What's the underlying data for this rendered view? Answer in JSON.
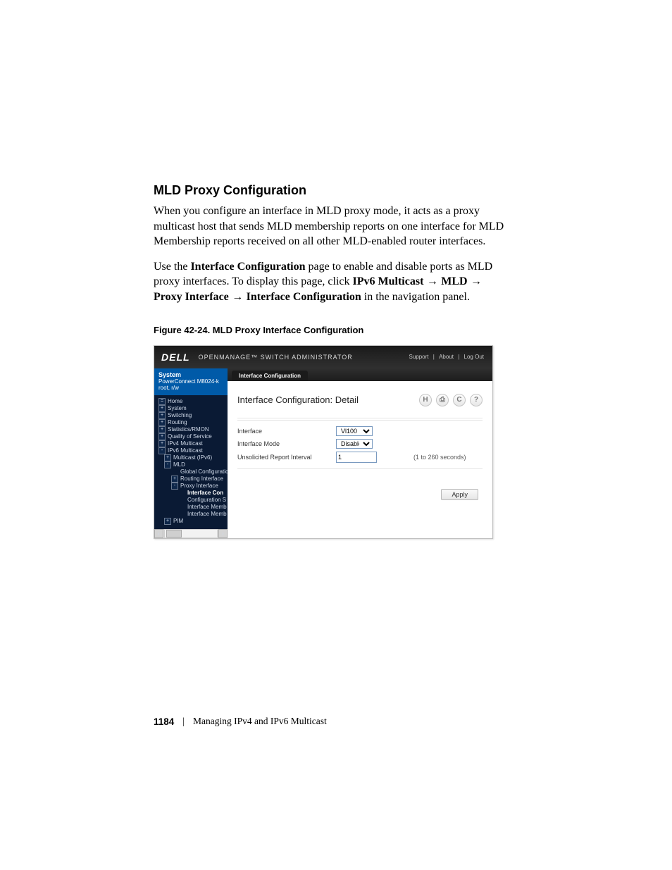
{
  "doc": {
    "section_title": "MLD Proxy Configuration",
    "p1": "When you configure an interface in MLD proxy mode, it acts as a proxy multicast host that sends MLD membership reports on one interface for MLD Membership reports received on all other MLD-enabled router interfaces.",
    "p2a": "Use the ",
    "p2_link": "Interface Configuration",
    "p2b": " page to enable and disable ports as MLD proxy interfaces. To display this page, click ",
    "bc1": "IPv6 Multicast",
    "bc2": "MLD",
    "bc3": "Proxy Interface",
    "bc4": "Interface Configuration",
    "p2c": " in the navigation panel.",
    "fig_caption": "Figure 42-24.    MLD Proxy Interface Configuration"
  },
  "shot": {
    "brand": "DELL",
    "subtitle": "OPENMANAGE™ SWITCH ADMINISTRATOR",
    "top_links": {
      "support": "Support",
      "about": "About",
      "logout": "Log Out"
    },
    "sidebar": {
      "sys_title": "System",
      "sys_line1": "PowerConnect M8024-k",
      "sys_line2": "root, r/w",
      "items": [
        {
          "toggle": "=",
          "label": "Home",
          "cls": ""
        },
        {
          "toggle": "+",
          "label": "System",
          "cls": ""
        },
        {
          "toggle": "+",
          "label": "Switching",
          "cls": ""
        },
        {
          "toggle": "+",
          "label": "Routing",
          "cls": ""
        },
        {
          "toggle": "+",
          "label": "Statistics/RMON",
          "cls": ""
        },
        {
          "toggle": "+",
          "label": "Quality of Service",
          "cls": ""
        },
        {
          "toggle": "+",
          "label": "IPv4 Multicast",
          "cls": ""
        },
        {
          "toggle": "-",
          "label": "IPv6 Multicast",
          "cls": ""
        },
        {
          "toggle": "+",
          "label": "Multicast (IPv6)",
          "cls": "ind1"
        },
        {
          "toggle": "-",
          "label": "MLD",
          "cls": "ind1"
        },
        {
          "toggle": "",
          "label": "Global Configuratio",
          "cls": "ind2 noicon"
        },
        {
          "toggle": "+",
          "label": "Routing Interface",
          "cls": "ind2"
        },
        {
          "toggle": "-",
          "label": "Proxy Interface",
          "cls": "ind2"
        },
        {
          "toggle": "",
          "label": "Interface Con",
          "cls": "ind3 noicon sel"
        },
        {
          "toggle": "",
          "label": "Configuration S",
          "cls": "ind3 noicon"
        },
        {
          "toggle": "",
          "label": "Interface Memb",
          "cls": "ind3 noicon"
        },
        {
          "toggle": "",
          "label": "Interface Memb",
          "cls": "ind3 noicon"
        },
        {
          "toggle": "+",
          "label": "PIM",
          "cls": "ind1"
        }
      ]
    },
    "tab": "Interface Configuration",
    "panel_title": "Interface Configuration: Detail",
    "icons": {
      "save": "H",
      "print": "⎙",
      "refresh": "C",
      "help": "?"
    },
    "form": {
      "row1": {
        "label": "Interface",
        "value": "Vl100"
      },
      "row2": {
        "label": "Interface Mode",
        "value": "Disable"
      },
      "row3": {
        "label": "Unsolicited Report Interval",
        "value": "1",
        "hint": "(1 to 260 seconds)"
      }
    },
    "apply": "Apply"
  },
  "footer": {
    "page": "1184",
    "sep": "|",
    "chapter": "Managing IPv4 and IPv6 Multicast"
  }
}
